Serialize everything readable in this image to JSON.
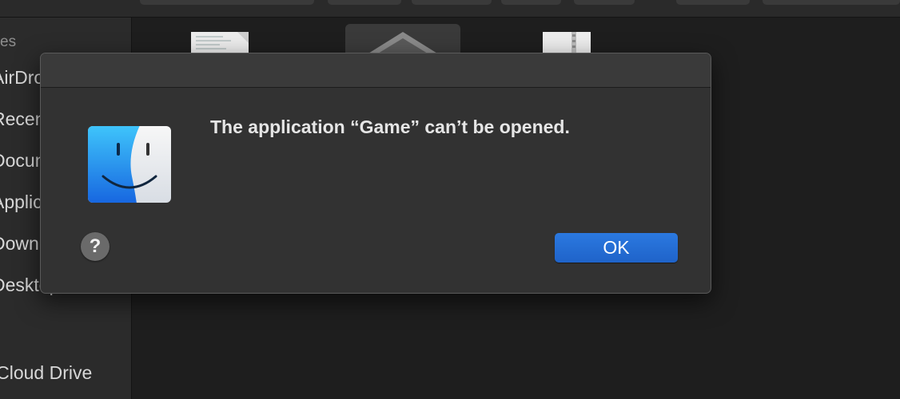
{
  "sidebar": {
    "heading": "es",
    "items": [
      {
        "label": "AirDrop",
        "icon": "airdrop-icon"
      },
      {
        "label": "Recents",
        "icon": "clock-icon"
      },
      {
        "label": "Documents",
        "icon": "document-icon"
      },
      {
        "label": "Applications",
        "icon": "applications-icon"
      },
      {
        "label": "Downloads",
        "icon": "download-icon"
      },
      {
        "label": "Desktop",
        "icon": "desktop-icon"
      },
      {
        "label": "iCloud Drive",
        "icon": "cloud-icon"
      }
    ]
  },
  "dialog": {
    "icon": "finder-icon",
    "message": "The application “Game” can’t be opened.",
    "help_label": "?",
    "ok_label": "OK"
  },
  "colors": {
    "accent": "#2b79e0",
    "dialog_bg": "#323232",
    "sidebar_bg": "#2b2b2b"
  }
}
